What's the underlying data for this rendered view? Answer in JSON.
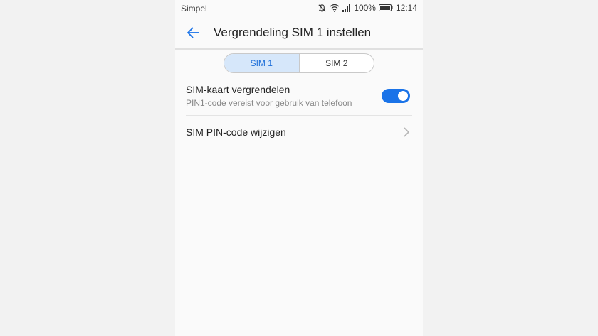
{
  "statusbar": {
    "carrier": "Simpel",
    "battery_percent": "100%",
    "time": "12:14",
    "icons": [
      "mute-icon",
      "wifi-icon",
      "signal-icon",
      "battery-icon"
    ]
  },
  "header": {
    "back_icon": "arrow-left-icon",
    "title": "Vergrendeling SIM 1 instellen"
  },
  "tabs": [
    {
      "label": "SIM 1",
      "selected": true
    },
    {
      "label": "SIM 2",
      "selected": false
    }
  ],
  "settings": [
    {
      "title": "SIM-kaart vergrendelen",
      "subtitle": "PIN1-code vereist voor gebruik van telefoon",
      "toggle_on": true
    },
    {
      "title": "SIM PIN-code wijzigen",
      "icon": "chevron-right-icon"
    }
  ],
  "colors": {
    "accent": "#1a73e8",
    "tab_selected_bg": "#d6e7fa",
    "background": "#fafafa"
  }
}
